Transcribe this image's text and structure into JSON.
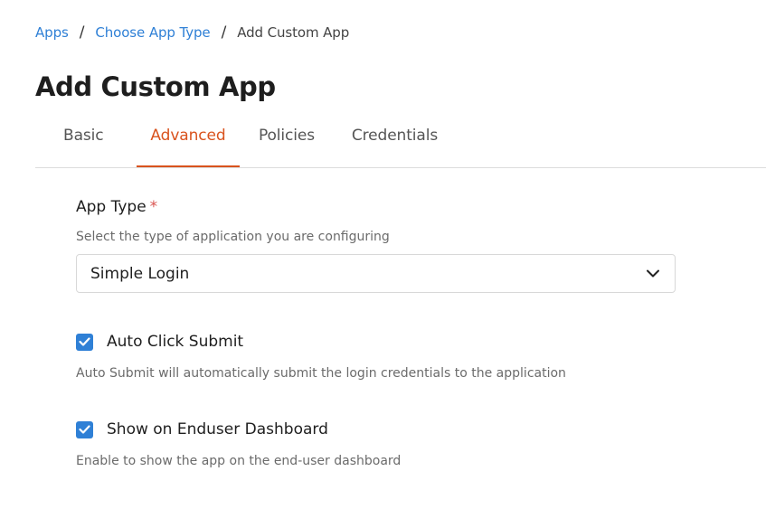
{
  "breadcrumb": {
    "items": [
      "Apps",
      "Choose App Type"
    ],
    "current": "Add Custom App",
    "separator": "/"
  },
  "page": {
    "title": "Add Custom App"
  },
  "tabs": [
    {
      "label": "Basic",
      "active": false
    },
    {
      "label": "Advanced",
      "active": true
    },
    {
      "label": "Policies",
      "active": false
    },
    {
      "label": "Credentials",
      "active": false
    }
  ],
  "form": {
    "app_type": {
      "label": "App Type",
      "required_marker": "*",
      "help": "Select the type of application you are configuring",
      "value": "Simple Login",
      "icon": "chevron-down-icon"
    },
    "auto_click_submit": {
      "label": "Auto Click Submit",
      "checked": true,
      "help": "Auto Submit will automatically submit the login credentials to the application"
    },
    "show_on_dashboard": {
      "label": "Show on Enduser Dashboard",
      "checked": true,
      "help": "Enable to show the app on the end-user dashboard"
    }
  },
  "colors": {
    "link": "#2f80d6",
    "active_tab": "#d9531e",
    "checkbox": "#2f80d6",
    "required": "#d9534f"
  }
}
